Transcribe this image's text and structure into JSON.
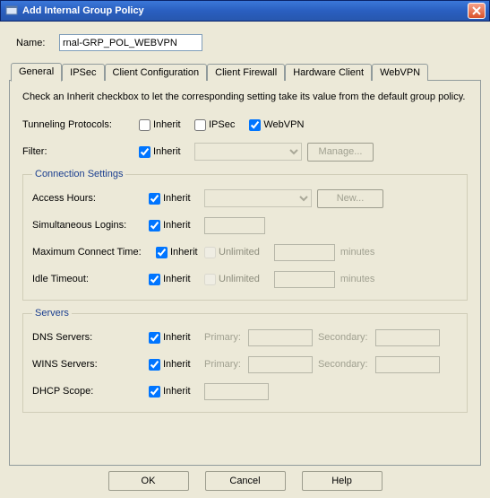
{
  "window": {
    "title": "Add Internal Group Policy"
  },
  "name": {
    "label": "Name:",
    "value": "rnal-GRP_POL_WEBVPN"
  },
  "tabs": [
    {
      "label": "General"
    },
    {
      "label": "IPSec"
    },
    {
      "label": "Client Configuration"
    },
    {
      "label": "Client Firewall"
    },
    {
      "label": "Hardware Client"
    },
    {
      "label": "WebVPN"
    }
  ],
  "panel": {
    "description": "Check an Inherit checkbox to let the corresponding setting take its value from the default group policy.",
    "tunneling": {
      "label": "Tunneling Protocols:",
      "inherit_label": "Inherit",
      "inherit_checked": false,
      "ipsec_label": "IPSec",
      "ipsec_checked": false,
      "webvpn_label": "WebVPN",
      "webvpn_checked": true
    },
    "filter": {
      "label": "Filter:",
      "inherit_label": "Inherit",
      "inherit_checked": true,
      "manage_label": "Manage..."
    },
    "conn": {
      "legend": "Connection Settings",
      "access_hours": {
        "label": "Access Hours:",
        "inherit_label": "Inherit",
        "inherit_checked": true,
        "new_label": "New..."
      },
      "sim_logins": {
        "label": "Simultaneous Logins:",
        "inherit_label": "Inherit",
        "inherit_checked": true
      },
      "max_connect": {
        "label": "Maximum Connect Time:",
        "inherit_label": "Inherit",
        "inherit_checked": true,
        "unlimited_label": "Unlimited",
        "unit": "minutes"
      },
      "idle_timeout": {
        "label": "Idle Timeout:",
        "inherit_label": "Inherit",
        "inherit_checked": true,
        "unlimited_label": "Unlimited",
        "unit": "minutes"
      }
    },
    "servers": {
      "legend": "Servers",
      "dns": {
        "label": "DNS Servers:",
        "inherit_label": "Inherit",
        "inherit_checked": true,
        "primary_label": "Primary:",
        "secondary_label": "Secondary:"
      },
      "wins": {
        "label": "WINS Servers:",
        "inherit_label": "Inherit",
        "inherit_checked": true,
        "primary_label": "Primary:",
        "secondary_label": "Secondary:"
      },
      "dhcp": {
        "label": "DHCP Scope:",
        "inherit_label": "Inherit",
        "inherit_checked": true
      }
    }
  },
  "buttons": {
    "ok": "OK",
    "cancel": "Cancel",
    "help": "Help"
  }
}
